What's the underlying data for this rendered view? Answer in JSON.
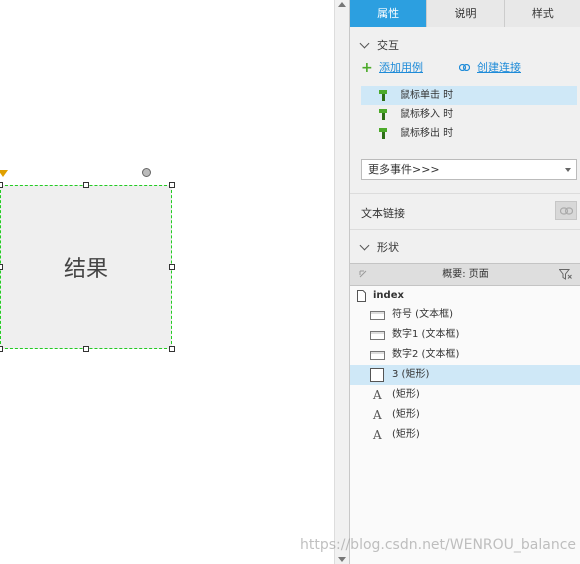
{
  "canvas": {
    "shape_label": "结果"
  },
  "tabs": [
    {
      "label": "属性",
      "active": true
    },
    {
      "label": "说明",
      "active": false
    },
    {
      "label": "样式",
      "active": false
    }
  ],
  "interaction": {
    "section_title": "交互",
    "add_case": "添加用例",
    "create_link": "创建连接",
    "events": [
      {
        "label": "鼠标单击 时",
        "selected": true
      },
      {
        "label": "鼠标移入 时",
        "selected": false
      },
      {
        "label": "鼠标移出 时",
        "selected": false
      }
    ],
    "more_events": "更多事件>>>"
  },
  "text_link": {
    "label": "文本链接"
  },
  "shape_section": {
    "title": "形状"
  },
  "outline": {
    "title": "概要: 页面",
    "root": "index",
    "items": [
      {
        "label": "符号 (文本框)",
        "icon": "textbox-icon",
        "selected": false
      },
      {
        "label": "数字1 (文本框)",
        "icon": "textbox-icon",
        "selected": false
      },
      {
        "label": "数字2 (文本框)",
        "icon": "textbox-icon",
        "selected": false
      },
      {
        "label": "3 (矩形)",
        "icon": "rectangle-icon",
        "selected": true
      },
      {
        "label": "(矩形)",
        "icon": "text-label-icon",
        "selected": false
      },
      {
        "label": "(矩形)",
        "icon": "text-label-icon",
        "selected": false
      },
      {
        "label": "(矩形)",
        "icon": "text-label-icon",
        "selected": false
      }
    ]
  },
  "watermark": "https://blog.csdn.net/WENROU_balance",
  "colors": {
    "accent": "#2c9fe0",
    "link": "#1e8bd8",
    "selection": "#cfe8f7",
    "shape_border": "#22cc22",
    "add_green": "#4caa2a"
  }
}
